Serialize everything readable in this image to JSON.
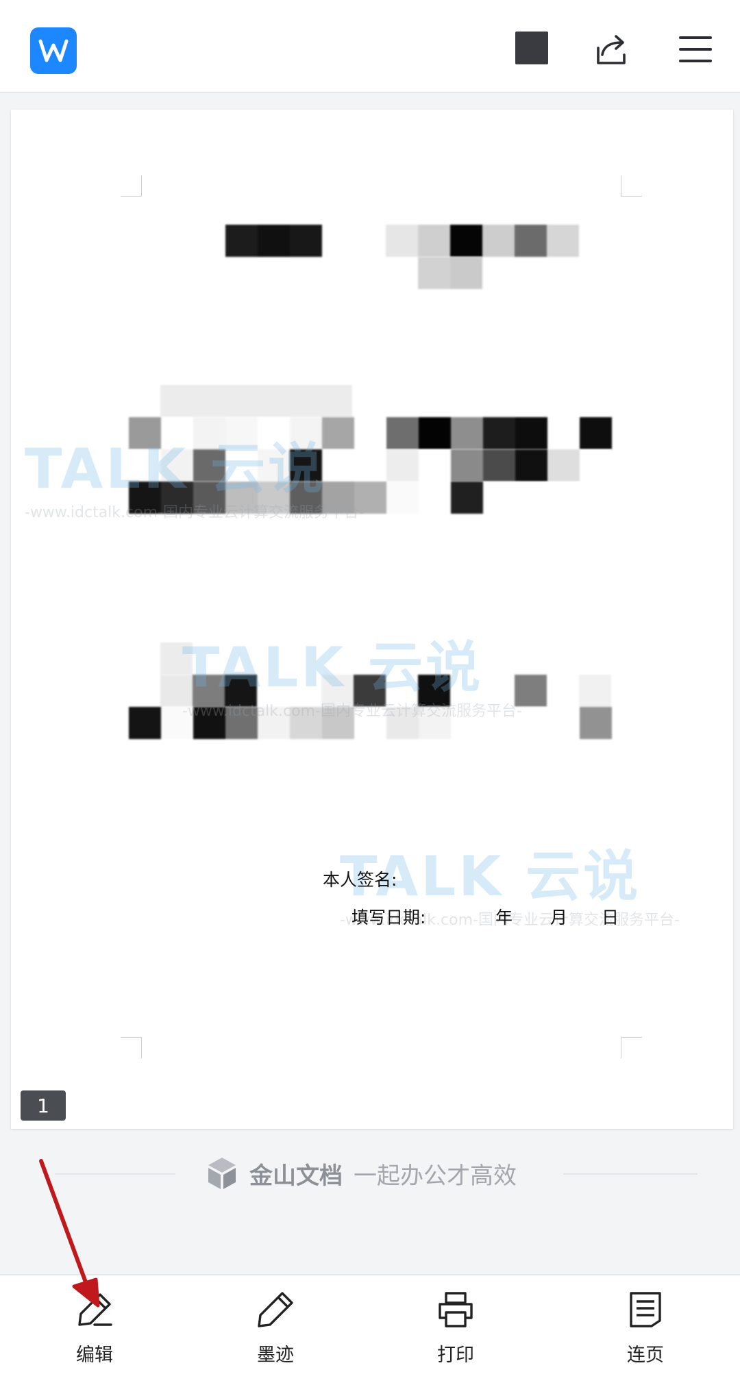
{
  "header": {
    "logo_icon": "wps-writer-logo-icon",
    "share_icon": "share-icon",
    "menu_icon": "hamburger-menu-icon"
  },
  "document": {
    "signature_label": "本人签名:",
    "date_label": "填写日期:",
    "year": "年",
    "month": "月",
    "day": "日",
    "page_number": "1",
    "watermark": {
      "logo": "TALK 云说",
      "subtitle": "-www.idctalk.com-国内专业云计算交流服务平台-"
    }
  },
  "branding": {
    "name": "金山文档",
    "slogan": "一起办公才高效"
  },
  "toolbar": {
    "edit": "编辑",
    "ink": "墨迹",
    "print": "打印",
    "continuous": "连页"
  },
  "colors": {
    "logo_blue": "#1d87ff",
    "annotation_arrow": "#c0191d"
  }
}
